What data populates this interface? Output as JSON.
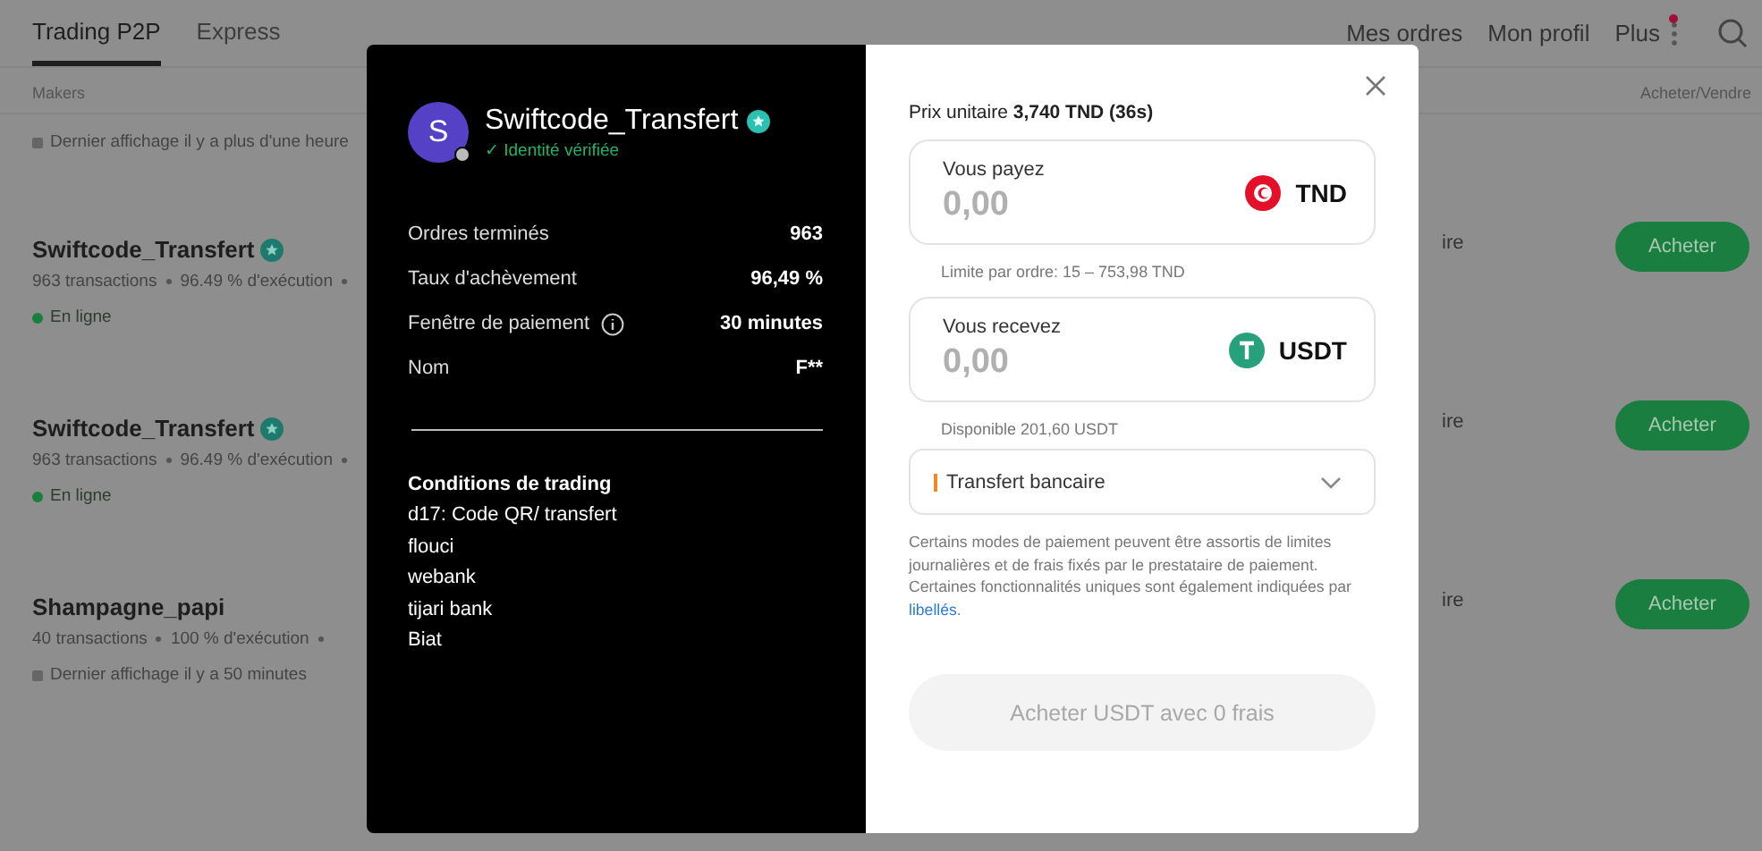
{
  "nav": {
    "tabs": [
      {
        "label": "Trading P2P",
        "selected": true
      },
      {
        "label": "Express",
        "selected": false
      }
    ],
    "links": [
      "Mes ordres",
      "Mon profil"
    ],
    "more": {
      "label": "Plus",
      "badge": true
    }
  },
  "table": {
    "columns": [
      "Makers",
      "Acheter/Vendre"
    ],
    "partial_row": {
      "status": "Dernier affichage il y a plus d'une heure",
      "online": false
    },
    "rows": [
      {
        "name": "Swiftcode_Transfert",
        "verified": true,
        "stats": [
          "963 transactions",
          "96.49 % d'exécution"
        ],
        "status": "En ligne",
        "online": true,
        "column_3": "ire",
        "action": "Acheter"
      },
      {
        "name": "Swiftcode_Transfert",
        "verified": true,
        "stats": [
          "963 transactions",
          "96.49 % d'exécution"
        ],
        "status": "En ligne",
        "online": true,
        "column_3": "ire",
        "action": "Acheter"
      },
      {
        "name": "Shampagne_papi",
        "verified": false,
        "stats": [
          "40 transactions",
          "100 % d'exécution"
        ],
        "status": "Dernier affichage il y a 50 minutes",
        "online": false,
        "column_3": "ire",
        "action": "Acheter"
      }
    ]
  },
  "modal": {
    "maker": {
      "avatar": "S",
      "name": "Swiftcode_Transfert",
      "verified": true,
      "identity": "✓ Identité vérifiée",
      "stats": [
        {
          "label": "Ordres terminés",
          "value": "963",
          "info": false
        },
        {
          "label": "Taux d'achèvement",
          "value": "96,49 %",
          "info": false
        },
        {
          "label": "Fenêtre de paiement",
          "value": "30 minutes",
          "info": true
        },
        {
          "label": "Nom",
          "value": "F**",
          "info": false
        }
      ],
      "conditions_title": "Conditions de trading",
      "conditions": [
        "d17: Code QR/ transfert",
        "flouci",
        "webank",
        "tijari bank",
        "Biat"
      ]
    },
    "price": "Prix unitaire **3,740 TND (36s)**",
    "fields": [
      {
        "label": "Vous payez",
        "placeholder": "0,00",
        "currency": "TND",
        "kind": "tnd",
        "hint": "Limite par ordre: 15 – 753,98 TND"
      },
      {
        "label": "Vous recevez",
        "placeholder": "0,00",
        "currency": "USDT",
        "kind": "usdt",
        "hint": "Disponible 201,60 USDT"
      }
    ],
    "payment": "Transfert bancaire",
    "note": "Certains modes de paiement peuvent être assortis de limites journalières et de frais fixés par le prestataire de paiement. Certaines fonctionnalités uniques sont également indiquées par",
    "note_link": "libellés",
    "note_end": ".",
    "submit": {
      "label": "Acheter USDT avec 0 frais",
      "disabled": true
    }
  }
}
